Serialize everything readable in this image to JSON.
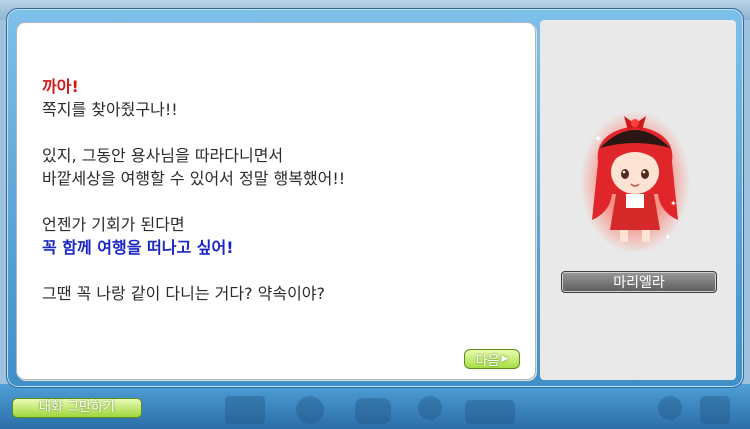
{
  "dialog": {
    "lines": [
      "까아!",
      "쪽지를 찾아줬구나!!",
      "있지, 그동안 용사님을 따라다니면서",
      "바깥세상을 여행할 수 있어서 정말 행복했어!!",
      "언젠가 기회가 된다면",
      "꼭 함께 여행을 떠나고 싶어!",
      "그땐 꼭 나랑 같이 다니는 거다? 약속이야?"
    ]
  },
  "buttons": {
    "next_label": "다음",
    "end_chat_label": "대화 그만하기"
  },
  "npc": {
    "name": "마리엘라"
  },
  "colors": {
    "exclaim": "#d01818",
    "highlight": "#1b27c4",
    "button_green": "#a6df44",
    "frame_blue": "#3f8fc8"
  }
}
